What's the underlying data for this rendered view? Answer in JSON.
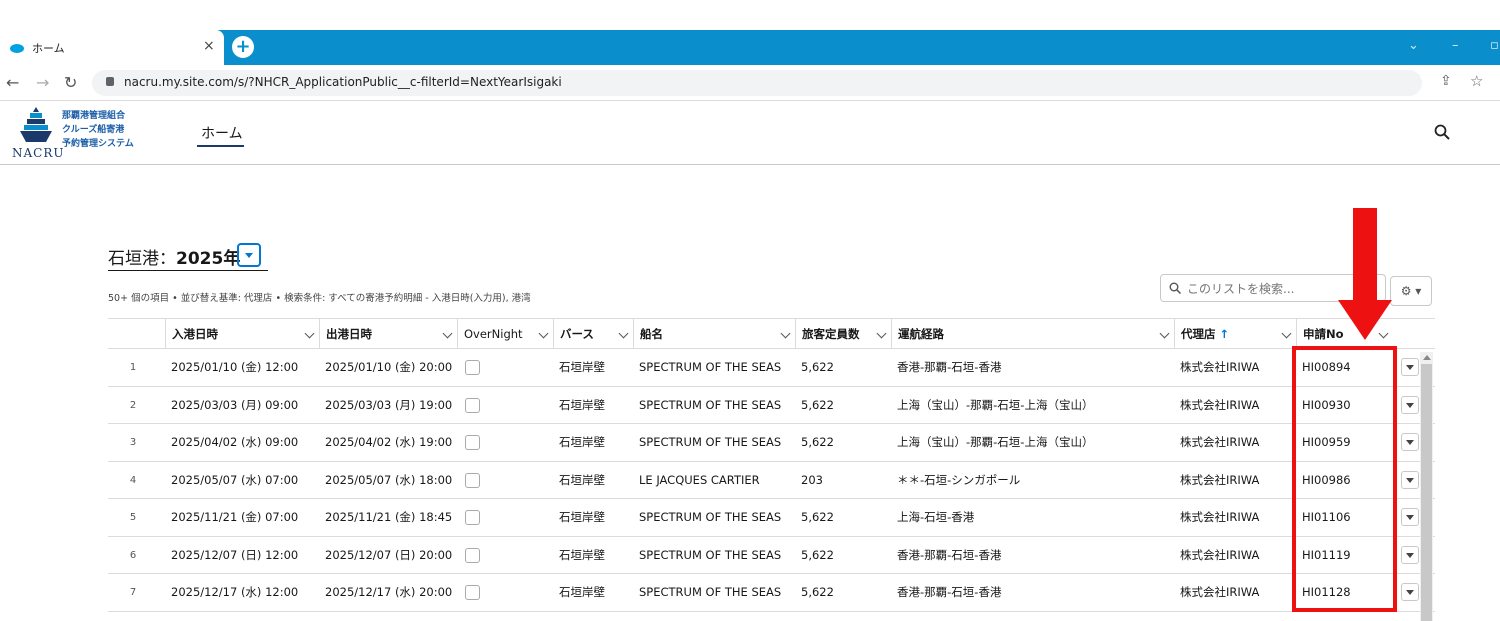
{
  "browser": {
    "tab_title": "ホーム",
    "tab_close": "×",
    "new_tab": "+",
    "url": "nacru.my.site.com/s/?NHCR_ApplicationPublic__c-filterId=NextYearIsigaki"
  },
  "header": {
    "logo_lines": [
      "那覇港管理組合",
      "クルーズ船寄港",
      "予約管理システム"
    ],
    "logo_text": "NACRU",
    "nav_home": "ホーム"
  },
  "listview": {
    "title_prefix": "石垣港：",
    "title_year": "2025年",
    "meta": "50+ 個の項目 • 並び替え基準: 代理店 • 検索条件: すべての寄港予約明細 - 入港日時(入力用), 港湾",
    "search_placeholder": "このリストを検索..."
  },
  "table": {
    "columns": [
      "入港日時",
      "出港日時",
      "OverNight",
      "バース",
      "船名",
      "旅客定員数",
      "運航経路",
      "代理店",
      "申請No"
    ],
    "sort_arrow": "↑",
    "rows": [
      {
        "n": "1",
        "arrive": "2025/01/10 (金) 12:00",
        "depart": "2025/01/10 (金) 20:00",
        "berth": "石垣岸壁",
        "ship": "SPECTRUM OF THE SEAS",
        "capacity": "5,622",
        "route": "香港-那覇-石垣-香港",
        "agent": "株式会社IRIWA",
        "appno": "HI00894"
      },
      {
        "n": "2",
        "arrive": "2025/03/03 (月) 09:00",
        "depart": "2025/03/03 (月) 19:00",
        "berth": "石垣岸壁",
        "ship": "SPECTRUM OF THE SEAS",
        "capacity": "5,622",
        "route": "上海（宝山）-那覇-石垣-上海（宝山）",
        "agent": "株式会社IRIWA",
        "appno": "HI00930"
      },
      {
        "n": "3",
        "arrive": "2025/04/02 (水) 09:00",
        "depart": "2025/04/02 (水) 19:00",
        "berth": "石垣岸壁",
        "ship": "SPECTRUM OF THE SEAS",
        "capacity": "5,622",
        "route": "上海（宝山）-那覇-石垣-上海（宝山）",
        "agent": "株式会社IRIWA",
        "appno": "HI00959"
      },
      {
        "n": "4",
        "arrive": "2025/05/07 (水) 07:00",
        "depart": "2025/05/07 (水) 18:00",
        "berth": "石垣岸壁",
        "ship": "LE JACQUES CARTIER",
        "capacity": "203",
        "route": "＊＊-石垣-シンガポール",
        "agent": "株式会社IRIWA",
        "appno": "HI00986"
      },
      {
        "n": "5",
        "arrive": "2025/11/21 (金) 07:00",
        "depart": "2025/11/21 (金) 18:45",
        "berth": "石垣岸壁",
        "ship": "SPECTRUM OF THE SEAS",
        "capacity": "5,622",
        "route": "上海-石垣-香港",
        "agent": "株式会社IRIWA",
        "appno": "HI01106"
      },
      {
        "n": "6",
        "arrive": "2025/12/07 (日) 12:00",
        "depart": "2025/12/07 (日) 20:00",
        "berth": "石垣岸壁",
        "ship": "SPECTRUM OF THE SEAS",
        "capacity": "5,622",
        "route": "香港-那覇-石垣-香港",
        "agent": "株式会社IRIWA",
        "appno": "HI01119"
      },
      {
        "n": "7",
        "arrive": "2025/12/17 (水) 12:00",
        "depart": "2025/12/17 (水) 20:00",
        "berth": "石垣岸壁",
        "ship": "SPECTRUM OF THE SEAS",
        "capacity": "5,622",
        "route": "香港-那覇-石垣-香港",
        "agent": "株式会社IRIWA",
        "appno": "HI01128"
      }
    ]
  },
  "colors": {
    "chrome_blue": "#0b8fcc",
    "accent_blue": "#0176d3",
    "annotation_red": "#ee1111"
  }
}
